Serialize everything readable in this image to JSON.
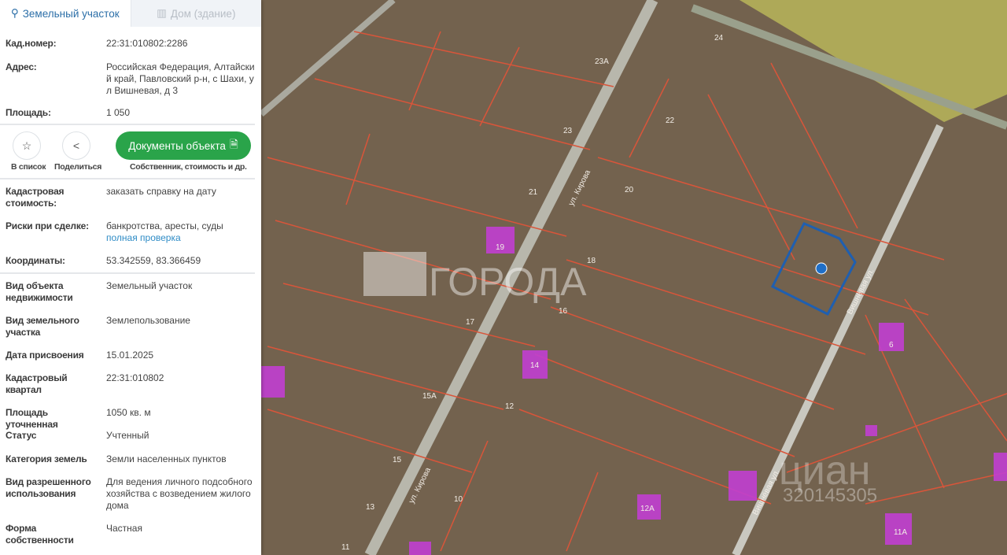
{
  "tabs": [
    {
      "label": "Земельный участок",
      "icon": "map-pin-icon",
      "active": true
    },
    {
      "label": "Дом (здание)",
      "icon": "building-icon",
      "active": false
    }
  ],
  "summary": {
    "cad_number": {
      "label": "Кад.номер:",
      "value": "22:31:010802:2286"
    },
    "address": {
      "label": "Адрес:",
      "value": "Российская Федерация, Алтайский край, Павловский р-н, с Шахи, ул Вишневая, д 3"
    },
    "area": {
      "label": "Площадь:",
      "value": "1 050"
    }
  },
  "actions": {
    "favorite": {
      "label": "В список",
      "icon": "star-icon"
    },
    "share": {
      "label": "Поделиться",
      "icon": "share-icon"
    },
    "documents": {
      "label": "Документы объекта",
      "caption": "Собственник, стоимость и др.",
      "icon": "document-icon"
    }
  },
  "extra": {
    "cad_cost": {
      "label": "Кадастровая стоимость:",
      "link": "заказать справку на дату"
    },
    "risks": {
      "label": "Риски при сделке:",
      "value": "банкротства, аресты, суды",
      "link": "полная проверка"
    },
    "coords": {
      "label": "Координаты:",
      "value": "53.342559, 83.366459"
    }
  },
  "details": [
    {
      "label": "Вид объекта недвижимости",
      "value": "Земельный участок"
    },
    {
      "label": "Вид земельного участка",
      "value": "Землепользование"
    },
    {
      "label": "Дата присвоения",
      "value": "15.01.2025"
    },
    {
      "label": "Кадастровый квартал",
      "value": "22:31:010802"
    },
    {
      "label": "Площадь уточненная",
      "value": "1050 кв. м"
    },
    {
      "label": "Статус",
      "value": "Учтенный"
    },
    {
      "label": "Категория земель",
      "value": "Земли населенных пунктов"
    },
    {
      "label": "Вид разрешенного использования",
      "value": "Для ведения личного подсобного хозяйства с возведением жилого дома"
    },
    {
      "label": "Форма собственности",
      "value": "Частная"
    }
  ],
  "map": {
    "streets": [
      "ул. Кирова",
      "Вишнёвая ул."
    ],
    "houses": [
      "24",
      "23А",
      "22",
      "23",
      "21",
      "20",
      "19",
      "18",
      "17",
      "16",
      "14",
      "15А",
      "12",
      "15",
      "10",
      "12А",
      "13",
      "11",
      "6",
      "11А"
    ],
    "watermarks": [
      "ГОРОДА",
      "циан",
      "320145305"
    ],
    "colors": {
      "parcel": "#1f5fb0",
      "boundary": "#d9553a",
      "building": "#c13fd1"
    }
  }
}
